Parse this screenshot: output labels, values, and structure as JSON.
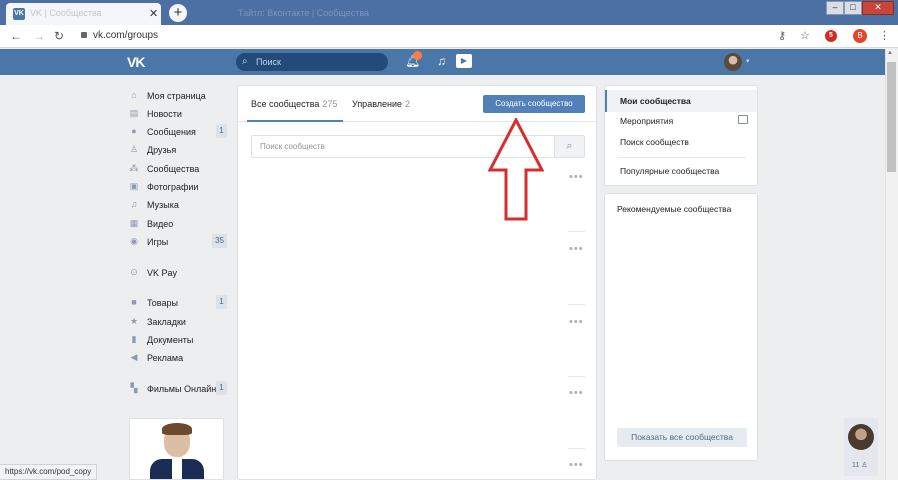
{
  "browser": {
    "tab_title": "VK | Сообщества",
    "tab_favicon": "vk-logo-icon",
    "tab_close": "✕",
    "new_tab": "+",
    "window_title": "Тайтл: Вконтакте | Сообщества",
    "url": "vk.com/groups",
    "ext_badge": "5",
    "profile_letter": "B",
    "window_buttons": [
      "–",
      "□",
      "✕"
    ]
  },
  "header": {
    "logo": "VK",
    "search_placeholder": "Поиск",
    "accent": "#4a76a8"
  },
  "menu": {
    "items": [
      {
        "label": "Моя страница",
        "icon": "home-icon",
        "count": ""
      },
      {
        "label": "Новости",
        "icon": "news-icon",
        "count": ""
      },
      {
        "label": "Сообщения",
        "icon": "messages-icon",
        "count": "1"
      },
      {
        "label": "Друзья",
        "icon": "friend-icon",
        "count": ""
      },
      {
        "label": "Сообщества",
        "icon": "groups-icon",
        "count": ""
      },
      {
        "label": "Фотографии",
        "icon": "camera-icon",
        "count": ""
      },
      {
        "label": "Музыка",
        "icon": "music-icon",
        "count": ""
      },
      {
        "label": "Видео",
        "icon": "video-icon",
        "count": ""
      },
      {
        "label": "Игры",
        "icon": "gamepad-icon",
        "count": "35"
      },
      {
        "label": "VK Pay",
        "icon": "pay-icon",
        "count": ""
      },
      {
        "label": "Товары",
        "icon": "bag-icon",
        "count": "1"
      },
      {
        "label": "Закладки",
        "icon": "star-icon",
        "count": ""
      },
      {
        "label": "Документы",
        "icon": "document-icon",
        "count": ""
      },
      {
        "label": "Реклама",
        "icon": "megaphone-icon",
        "count": ""
      },
      {
        "label": "Фильмы Онлайн",
        "icon": "apps-icon",
        "count": "1"
      }
    ]
  },
  "main": {
    "tabs": [
      {
        "label": "Все сообщества",
        "count": "275"
      },
      {
        "label": "Управление",
        "count": "2"
      }
    ],
    "create_button": "Создать сообщество",
    "search_placeholder": "Поиск сообществ",
    "more_glyph": "•••"
  },
  "right_nav": {
    "items": [
      {
        "label": "Мои сообщества",
        "active": true
      },
      {
        "label": "Мероприятия",
        "active": false
      },
      {
        "label": "Поиск сообществ",
        "active": false
      },
      {
        "label": "Популярные сообщества",
        "active": false
      }
    ]
  },
  "recommended": {
    "title": "Рекомендуемые сообщества",
    "show_all": "Показать все сообщества"
  },
  "friends_widget": {
    "count": "11"
  },
  "status_bar": "https://vk.com/pod_copy",
  "annotation": {
    "arrow_color": "#d62e2e"
  }
}
